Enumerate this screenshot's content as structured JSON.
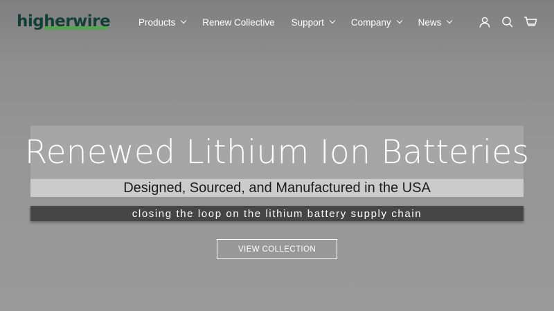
{
  "brand": {
    "name": "higherwire",
    "name_color": "#123f34",
    "tagline_color": "#4fa64b"
  },
  "nav": {
    "items": [
      {
        "label": "Products",
        "has_dropdown": true
      },
      {
        "label": "Renew Collective",
        "has_dropdown": false
      },
      {
        "label": "Support",
        "has_dropdown": true
      },
      {
        "label": "Company",
        "has_dropdown": true
      },
      {
        "label": "News",
        "has_dropdown": true
      }
    ],
    "icons": [
      "account-icon",
      "search-icon",
      "cart-icon"
    ]
  },
  "hero": {
    "headline": "Renewed Lithium Ion Batteries",
    "subheadline": "Designed, Sourced, and Manufactured in the USA",
    "tagline": "closing the loop on the lithium battery supply chain",
    "cta_label": "VIEW COLLECTION",
    "colors": {
      "headline_bg": "#a6a6a6",
      "subheadline_bg": "#cbcbcb",
      "tagline_bg": "#454545"
    }
  }
}
